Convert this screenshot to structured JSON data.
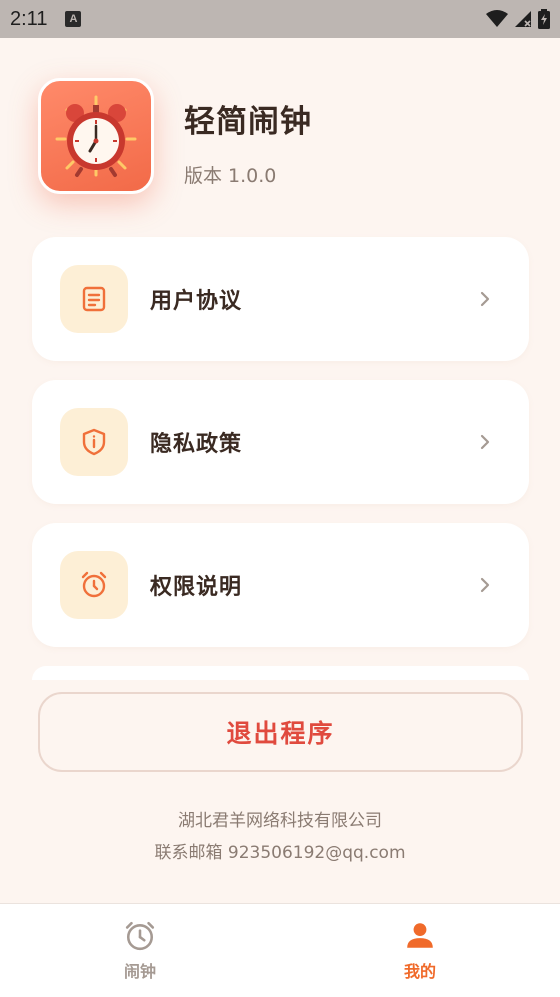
{
  "status_bar": {
    "time": "2:11",
    "notification_glyph": "A",
    "icons": [
      "wifi-icon",
      "signal-icon",
      "battery-icon"
    ]
  },
  "app": {
    "name": "轻简闹钟",
    "version": "版本 1.0.0",
    "icon": "alarm-clock-icon"
  },
  "menu": {
    "items": [
      {
        "label": "用户协议",
        "icon": "document-icon"
      },
      {
        "label": "隐私政策",
        "icon": "shield-icon"
      },
      {
        "label": "权限说明",
        "icon": "alarm-icon"
      }
    ]
  },
  "exit_button": {
    "label": "退出程序"
  },
  "footer": {
    "company": "湖北君羊网络科技有限公司",
    "contact": "联系邮箱 923506192@qq.com"
  },
  "bottom_nav": {
    "items": [
      {
        "label": "闹钟",
        "icon": "alarm-icon",
        "active": false
      },
      {
        "label": "我的",
        "icon": "user-icon",
        "active": true
      }
    ]
  },
  "colors": {
    "accent": "#f06a2a",
    "danger": "#e04a3e",
    "background": "#fdf5f0",
    "icon_bg": "#fdefd6"
  }
}
